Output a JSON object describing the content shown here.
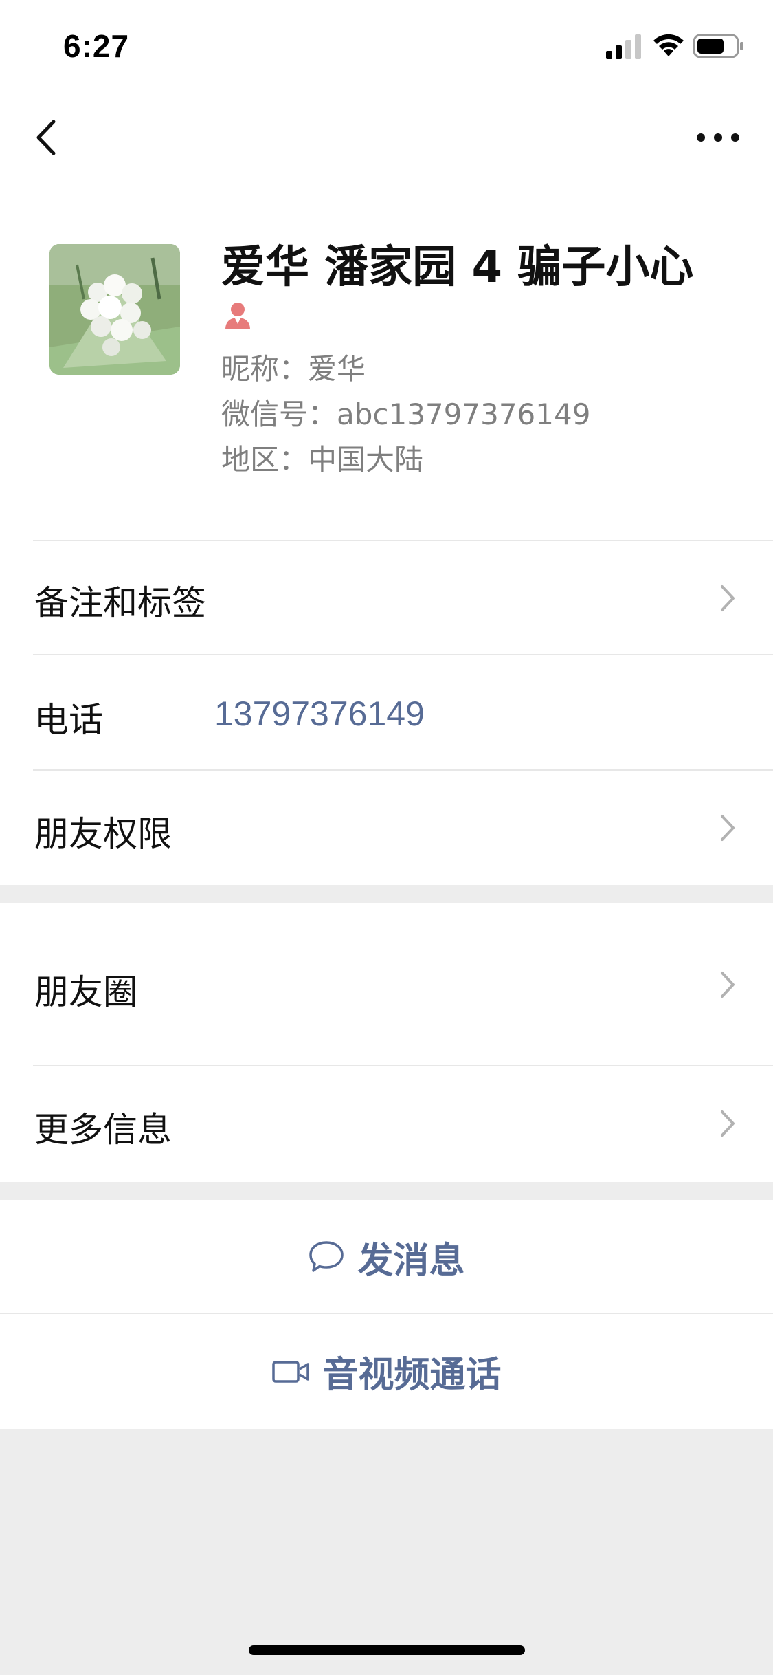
{
  "status_bar": {
    "time": "6:27"
  },
  "icons": {
    "back": "chevron-left-icon",
    "more": "ellipsis-icon",
    "gender": "female-icon",
    "chevron": "chevron-right-icon",
    "message": "chat-bubble-icon",
    "video": "video-camera-icon"
  },
  "profile": {
    "display_name": "爱华 潘家园 4 骗子小心",
    "nickname": "昵称：爱华",
    "wechat_id": "微信号：abc13797376149",
    "region": "地区：中国大陆"
  },
  "rows": {
    "remarks_tags": "备注和标签",
    "phone_label": "电话",
    "phone_value": "13797376149",
    "friend_permissions": "朋友权限",
    "moments": "朋友圈",
    "more_info": "更多信息"
  },
  "actions": {
    "send_message": "发消息",
    "video_call": "音视频通话"
  },
  "colors": {
    "accent_link": "#576b95",
    "gender_female": "#e77b7b",
    "background": "#ededed"
  }
}
